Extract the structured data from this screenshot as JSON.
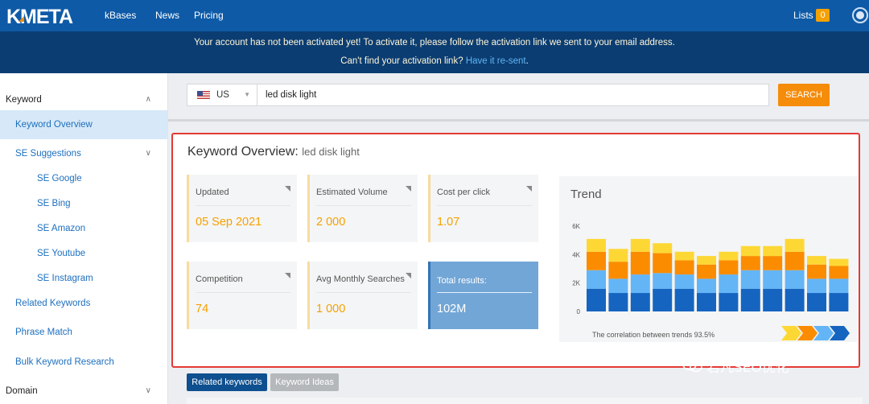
{
  "header": {
    "logo": "KWFINDER-style logo",
    "logo_text": "KMETA",
    "nav": [
      {
        "label": "kBases"
      },
      {
        "label": "News"
      },
      {
        "label": "Pricing"
      }
    ],
    "lists_label": "Lists",
    "lists_count": "0",
    "brand_color": "#0e5aa7"
  },
  "alert": {
    "line1": "Your account has not been activated yet! To activate it, please follow the activation link we sent to your email address.",
    "line2_prefix": "Can't find your activation link?",
    "line2_link": "Have it re-sent",
    "line2_suffix": "."
  },
  "sidebar": {
    "items": [
      {
        "label": "Keyword"
      },
      {
        "label": "Keyword Overview"
      },
      {
        "label": "SE Suggestions"
      },
      {
        "label": "SE Google"
      },
      {
        "label": "SE Bing"
      },
      {
        "label": "SE Amazon"
      },
      {
        "label": "SE Youtube"
      },
      {
        "label": "SE Instagram"
      },
      {
        "label": "Related Keywords"
      },
      {
        "label": "Phrase Match"
      },
      {
        "label": "Bulk Keyword Research"
      },
      {
        "label": "Domain"
      }
    ]
  },
  "search": {
    "country": "US",
    "query": "led disk light",
    "button": "SEARCH"
  },
  "overview": {
    "title": "Keyword Overview:",
    "keyword": "led disk light",
    "cards": [
      {
        "label": "Updated",
        "value": "05 Sep 2021"
      },
      {
        "label": "Estimated Volume",
        "value": "2 000"
      },
      {
        "label": "Cost per click",
        "value": "1.07"
      },
      {
        "label": "Competition",
        "value": "74"
      },
      {
        "label": "Avg Monthly Searches",
        "value": "1 000"
      },
      {
        "label": "Total results:",
        "value": "102M"
      }
    ]
  },
  "trend": {
    "title": "Trend",
    "caption": "The correlation between trends 93.5%",
    "chart_data": {
      "type": "bar",
      "ylim": [
        0,
        6000
      ],
      "yticks": [
        "0",
        "2K",
        "4K",
        "6K"
      ],
      "series_colors": [
        "#1565c0",
        "#64b5f6",
        "#fb8c00",
        "#fdd835"
      ],
      "bars": [
        [
          1600,
          1300,
          1300,
          900
        ],
        [
          1300,
          1000,
          1200,
          900
        ],
        [
          1300,
          1300,
          1600,
          900
        ],
        [
          1600,
          1100,
          1400,
          700
        ],
        [
          1600,
          1000,
          1000,
          600
        ],
        [
          1300,
          1000,
          1000,
          600
        ],
        [
          1300,
          1300,
          1000,
          600
        ],
        [
          1600,
          1300,
          1000,
          700
        ],
        [
          1600,
          1300,
          1000,
          700
        ],
        [
          1600,
          1300,
          1300,
          900
        ],
        [
          1300,
          1000,
          1000,
          600
        ],
        [
          1300,
          1000,
          900,
          500
        ]
      ]
    }
  },
  "tabs": [
    {
      "label": "Related keywords"
    },
    {
      "label": "Keyword Ideas"
    }
  ],
  "watermark": "若凡SEO优化"
}
